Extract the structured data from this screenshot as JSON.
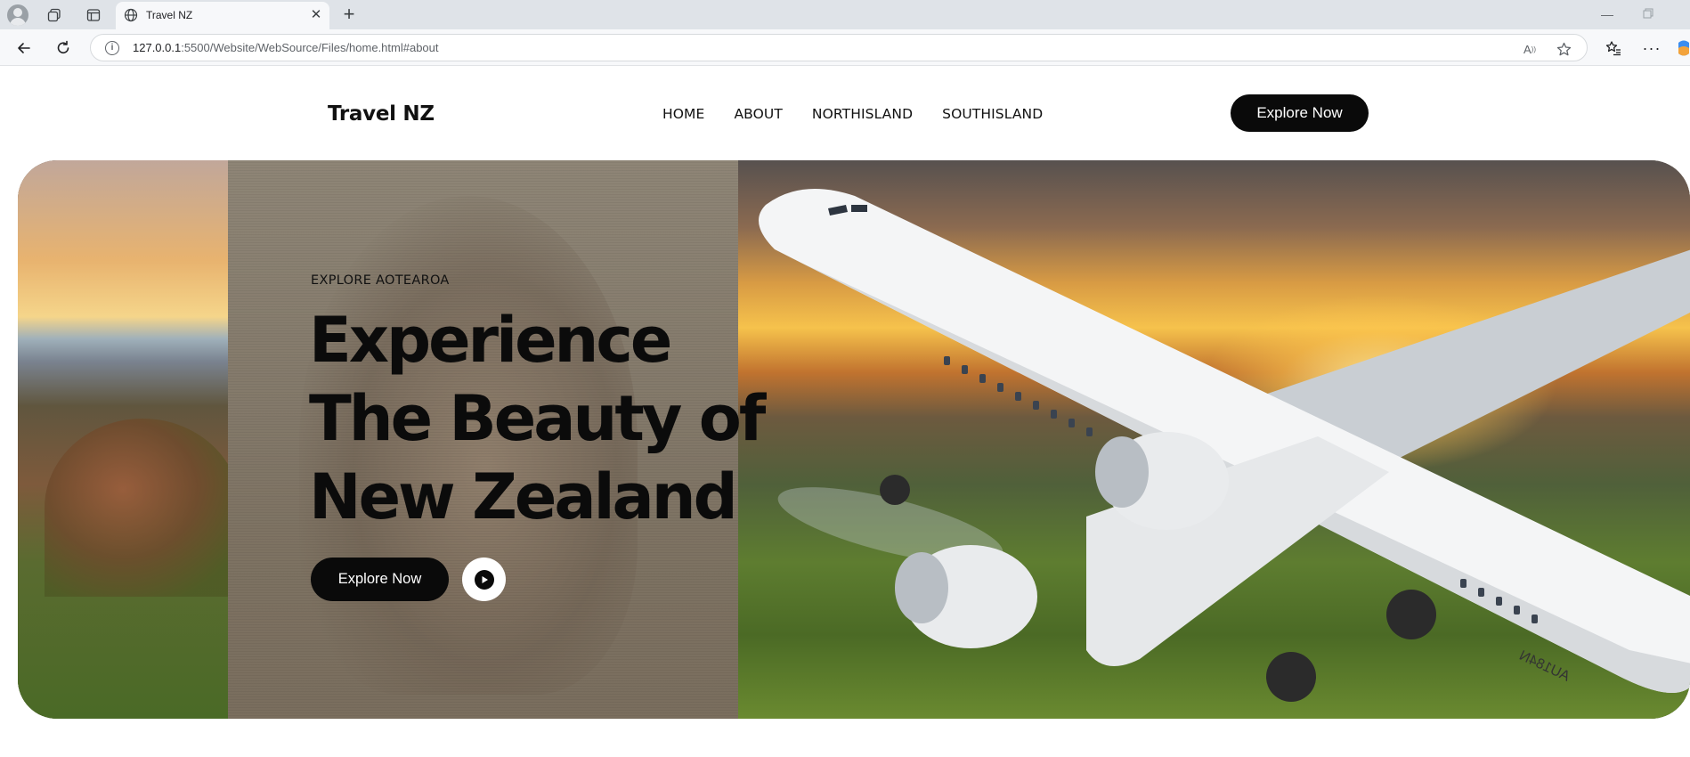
{
  "browser": {
    "tab_title": "Travel NZ",
    "url_host": "127.0.0.1",
    "url_rest": ":5500/Website/WebSource/Files/home.html#about",
    "icons": [
      "profile-icon",
      "workspaces-icon",
      "tab-actions-icon",
      "globe-icon",
      "close-icon",
      "plus-icon",
      "minimize-icon",
      "restore-icon",
      "back-icon",
      "reload-icon",
      "info-icon",
      "read-aloud-icon",
      "favorite-icon",
      "favorites-icon",
      "more-icon",
      "copilot-icon"
    ]
  },
  "header": {
    "brand": "Travel NZ",
    "nav": [
      {
        "label": "HOME"
      },
      {
        "label": "ABOUT"
      },
      {
        "label": "NORTHISLAND"
      },
      {
        "label": "SOUTHISLAND"
      }
    ],
    "cta_label": "Explore Now"
  },
  "hero": {
    "eyebrow": "EXPLORE AOTEAROA",
    "title_lines": [
      "Experience",
      "The Beauty of",
      "New Zealand"
    ],
    "cta_label": "Explore Now",
    "play_icon": "play-icon",
    "plane_registration": "AU184N"
  },
  "colors": {
    "button_bg": "#0a0a0a",
    "button_text": "#ffffff",
    "text": "#111111"
  }
}
